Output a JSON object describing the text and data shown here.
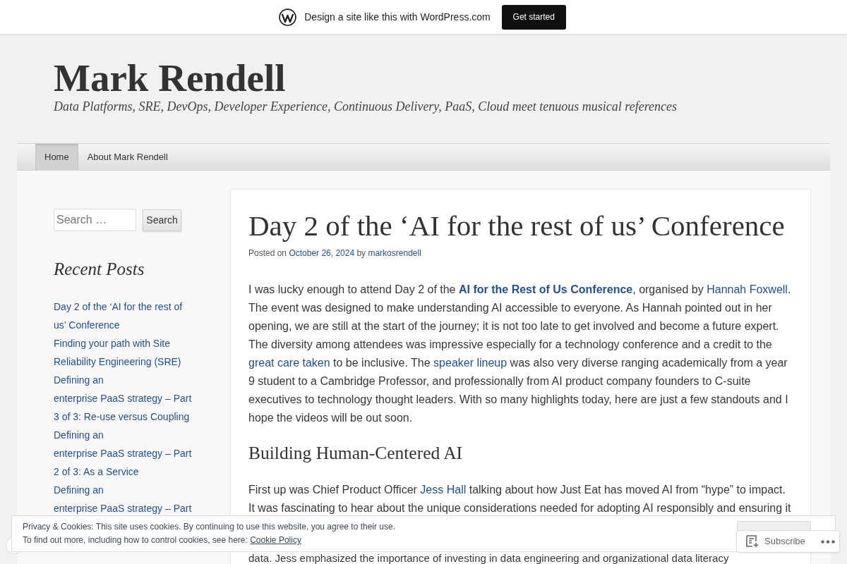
{
  "promo_bar": {
    "text": "Design a site like this with WordPress.com",
    "button": "Get started"
  },
  "site": {
    "title": "Mark Rendell",
    "tagline": "Data Platforms, SRE, DevOps, Developer Experience, Continuous Delivery, PaaS, Cloud meet tenuous musical references"
  },
  "nav": [
    {
      "label": "Home",
      "selected": true
    },
    {
      "label": "About Mark Rendell",
      "selected": false
    }
  ],
  "sidebar": {
    "search": {
      "placeholder": "Search …",
      "button": "Search"
    },
    "recent_posts": {
      "title": "Recent Posts",
      "items": [
        {
          "lines": [
            "Day 2 of the ‘AI for the rest of",
            "us’ Conference"
          ]
        },
        {
          "lines": [
            "Finding your path with Site",
            "Reliability Engineering (SRE)"
          ]
        },
        {
          "lines": [
            "Defining an",
            "enterprise PaaS strategy – Part",
            "3 of 3: Re-use versus Coupling"
          ]
        },
        {
          "lines": [
            "Defining an",
            "enterprise PaaS strategy – Part",
            "2 of 3: As a Service"
          ]
        },
        {
          "lines": [
            "Defining an",
            "enterprise PaaS strategy – Part"
          ]
        }
      ]
    }
  },
  "article": {
    "title": "Day 2 of the ‘AI for the rest of us’ Conference",
    "meta": [
      {
        "kind": "text",
        "text": "Posted on "
      },
      {
        "kind": "link",
        "text": "October 26, 2024",
        "bold": false
      },
      {
        "kind": "text",
        "text": " by "
      },
      {
        "kind": "link",
        "text": "markosrendell",
        "bold": false
      }
    ],
    "blocks": [
      {
        "kind": "paragraph",
        "parts": [
          [
            {
              "kind": "text",
              "text": "I was lucky enough to attend Day 2 of the "
            },
            {
              "kind": "link",
              "text": "AI for the Rest of Us Conference",
              "bold": true
            },
            {
              "kind": "text",
              "text": ", organised by "
            },
            {
              "kind": "link",
              "text": "Hannah Foxwell",
              "bold": false
            },
            {
              "kind": "text",
              "text": ". The event was designed to make understanding AI accessible to everyone. As Hannah pointed out in her opening, we are still at the start of the journey; it is not too late to get involved and become a future expert. The diversity among attendees was impressive especially for a technology conference and a credit to the "
            },
            {
              "kind": "link",
              "text": "great care taken",
              "bold": false
            },
            {
              "kind": "text",
              "text": " to be inclusive. The "
            },
            {
              "kind": "link",
              "text": "speaker lineup",
              "bold": false
            },
            {
              "kind": "text",
              "text": " was also very diverse ranging academically from a year 9 student to a Cambridge Professor, and professionally from AI product company founders to C-suite executives to technology thought leaders. With so many highlights today, here are just a few standouts and I hope the videos will be out soon."
            }
          ]
        ]
      },
      {
        "kind": "heading",
        "text": "Building Human-Centered AI"
      },
      {
        "kind": "paragraph",
        "parts": [
          [
            {
              "kind": "text",
              "text": "First up was Chief Product Officer "
            },
            {
              "kind": "link",
              "text": "Jess Hall",
              "bold": false
            },
            {
              "kind": "text",
              "text": " talking about how Just Eat has moved AI from “hype” to impact. It was fascinating to hear about the unique considerations needed for adopting AI responsibly and ensuring it"
            }
          ],
          [
            {
              "kind": "text",
              "text": "data. Jess emphasized the importance of investing in data engineering and organizational data literacy"
            }
          ]
        ]
      }
    ]
  },
  "cookie_notice": {
    "text": "Privacy & Cookies: This site uses cookies. By continuing to use this website, you agree to their use.",
    "more": "To find out more, including how to control cookies, see here: ",
    "link": "Cookie Policy"
  },
  "follow_bar": {
    "subscribe": "Subscribe"
  }
}
